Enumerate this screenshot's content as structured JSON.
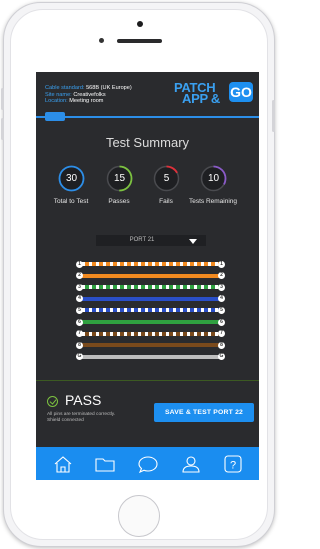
{
  "header": {
    "cable_standard_label": "Cable standard:",
    "cable_standard_value": "568B (UK Europe)",
    "site_name_label": "Site name:",
    "site_name_value": "Creativefolks",
    "location_label": "Location:",
    "location_value": "Meeting room",
    "logo_text_line1": "PATCH",
    "logo_text_line2": "APP &",
    "logo_go": "GO"
  },
  "summary": {
    "title": "Test Summary",
    "stats": [
      {
        "value": "30",
        "label": "Total to Test",
        "color": "#2c8ee8",
        "fraction": 1.0
      },
      {
        "value": "15",
        "label": "Passes",
        "color": "#7cc240",
        "fraction": 0.5
      },
      {
        "value": "5",
        "label": "Fails",
        "color": "#e0303a",
        "fraction": 0.17
      },
      {
        "value": "10",
        "label": "Tests Remaining",
        "color": "#8a5ac8",
        "fraction": 0.33
      }
    ]
  },
  "port_select": {
    "selected": "PORT 21"
  },
  "wires": [
    {
      "pin": "1",
      "color": "#f28a20",
      "striped": true
    },
    {
      "pin": "2",
      "color": "#f28a20",
      "striped": false
    },
    {
      "pin": "3",
      "color": "#2fa040",
      "striped": true
    },
    {
      "pin": "4",
      "color": "#2a4fc8",
      "striped": false
    },
    {
      "pin": "5",
      "color": "#2a4fc8",
      "striped": true
    },
    {
      "pin": "6",
      "color": "#2fa040",
      "striped": false
    },
    {
      "pin": "7",
      "color": "#7a4a1c",
      "striped": true
    },
    {
      "pin": "8",
      "color": "#7a4a1c",
      "striped": false
    },
    {
      "pin": "G",
      "color": "#bdbdbd",
      "striped": false
    }
  ],
  "result": {
    "status": "PASS",
    "description_line1": "All pins are terminated correctly.",
    "description_line2": "Shield connected",
    "save_button": "SAVE & TEST PORT 22"
  },
  "tabbar": {
    "icons": [
      "home-icon",
      "folder-icon",
      "chat-icon",
      "profile-icon",
      "help-icon"
    ],
    "help_glyph": "?"
  },
  "colors": {
    "accent": "#1d8ff0",
    "screen_bg": "#2a2b2e",
    "pass_green": "#7cc240"
  }
}
